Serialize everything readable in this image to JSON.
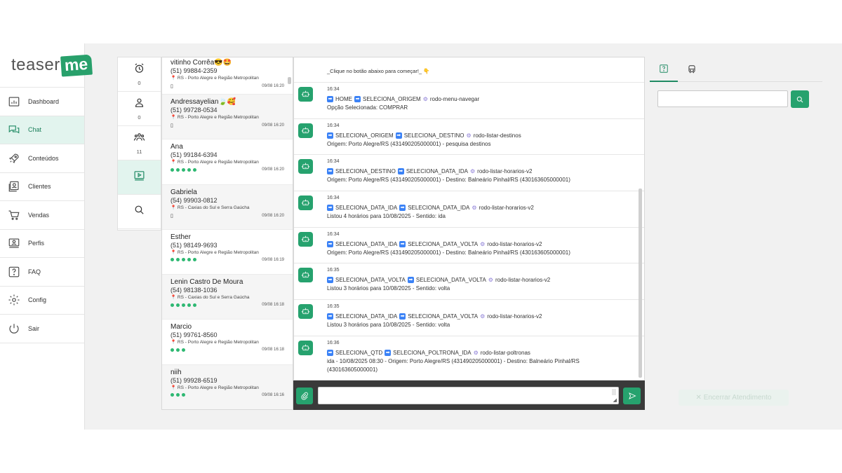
{
  "brand": {
    "word": "teaser",
    "mark": "me"
  },
  "nav": [
    {
      "label": "Dashboard",
      "icon": "chart-icon"
    },
    {
      "label": "Chat",
      "icon": "chat-icon",
      "active": true
    },
    {
      "label": "Conteúdos",
      "icon": "rocket-icon"
    },
    {
      "label": "Clientes",
      "icon": "contacts-icon"
    },
    {
      "label": "Vendas",
      "icon": "cart-icon"
    },
    {
      "label": "Perfis",
      "icon": "profile-icon"
    },
    {
      "label": "FAQ",
      "icon": "question-icon"
    },
    {
      "label": "Config",
      "icon": "gear-icon"
    },
    {
      "label": "Sair",
      "icon": "power-icon"
    }
  ],
  "queues": [
    {
      "icon": "alarm-icon",
      "count": "0"
    },
    {
      "icon": "person-icon",
      "count": "0"
    },
    {
      "icon": "group-icon",
      "count": "11"
    },
    {
      "icon": "play-icon",
      "count": ""
    },
    {
      "icon": "search-icon",
      "count": ""
    }
  ],
  "contacts": [
    {
      "name": "vitinho Corrêa😎🤩",
      "phone": "(51) 99884-2359",
      "region": "RS - Porto Alegre e Região Metropolitan",
      "status": "▯",
      "dots": 0,
      "time": "09/08 16:20"
    },
    {
      "name": "Andressayelian🍃🥰",
      "phone": "(51) 99728-0534",
      "region": "RS - Porto Alegre e Região Metropolitan",
      "status": "▯",
      "dots": 0,
      "time": "09/08 16:20"
    },
    {
      "name": "Ana",
      "phone": "(51) 99184-6394",
      "region": "RS - Porto Alegre e Região Metropolitan",
      "status": "",
      "dots": 5,
      "time": "09/08 16:20"
    },
    {
      "name": "Gabriela",
      "phone": "(54) 99903-0812",
      "region": "RS - Caxias do Sul e Serra Gaúcha",
      "status": "▯",
      "dots": 0,
      "time": "09/08 16:20"
    },
    {
      "name": "Esther",
      "phone": "(51) 98149-9693",
      "region": "RS - Porto Alegre e Região Metropolitan",
      "status": "",
      "dots": 5,
      "time": "09/08 16:19"
    },
    {
      "name": "Lenin Castro De Moura",
      "phone": "(54) 98138-1036",
      "region": "RS - Caxias do Sul e Serra Gaúcha",
      "status": "",
      "dots": 5,
      "time": "09/08 16:18"
    },
    {
      "name": "Marcio",
      "phone": "(51) 99761-8560",
      "region": "RS - Porto Alegre e Região Metropolitan",
      "status": "",
      "dots": 3,
      "time": "09/08 16:18"
    },
    {
      "name": "niih",
      "phone": "(51) 99928-6519",
      "region": "RS - Porto Alegre e Região Metropolitan",
      "status": "",
      "dots": 3,
      "time": "09/08 16:16"
    }
  ],
  "top_message": {
    "text": "_Clique no botão abaixo para começar!_",
    "emoji": "👇"
  },
  "messages": [
    {
      "time": "16:34",
      "from": "HOME",
      "to": "SELECIONA_ORIGEM",
      "action": "rodo-menu-navegar",
      "detail": "Opção Selecionada: COMPRAR"
    },
    {
      "time": "16:34",
      "from": "SELECIONA_ORIGEM",
      "to": "SELECIONA_DESTINO",
      "action": "rodo-listar-destinos",
      "detail": "Origem: Porto Alegre/RS (431490205000001) - pesquisa destinos"
    },
    {
      "time": "16:34",
      "from": "SELECIONA_DESTINO",
      "to": "SELECIONA_DATA_IDA",
      "action": "rodo-listar-horarios-v2",
      "detail": "Origem: Porto Alegre/RS (431490205000001) - Destino: Balneário Pinhal/RS (430163605000001)"
    },
    {
      "time": "16:34",
      "from": "SELECIONA_DATA_IDA",
      "to": "SELECIONA_DATA_IDA",
      "action": "rodo-listar-horarios-v2",
      "detail": "Listou 4 horários para 10/08/2025 - Sentido: ida"
    },
    {
      "time": "16:34",
      "from": "SELECIONA_DATA_IDA",
      "to": "SELECIONA_DATA_VOLTA",
      "action": "rodo-listar-horarios-v2",
      "detail": "Origem: Porto Alegre/RS (431490205000001) - Destino: Balneário Pinhal/RS (430163605000001)"
    },
    {
      "time": "16:35",
      "from": "SELECIONA_DATA_VOLTA",
      "to": "SELECIONA_DATA_VOLTA",
      "action": "rodo-listar-horarios-v2",
      "detail": "Listou 3 horários para 10/08/2025 - Sentido: volta"
    },
    {
      "time": "16:35",
      "from": "SELECIONA_DATA_IDA",
      "to": "SELECIONA_DATA_VOLTA",
      "action": "rodo-listar-horarios-v2",
      "detail": "Listou 3 horários para 10/08/2025 - Sentido: volta"
    },
    {
      "time": "16:36",
      "from": "SELECIONA_QTD",
      "to": "SELECIONA_POLTRONA_IDA",
      "action": "rodo-listar-poltronas",
      "detail": "ida - 10/08/2025 08:30 - Origem: Porto Alegre/RS (431490205000001) - Destino: Balneário Pinhal/RS (430163605000001)"
    }
  ],
  "compose": {
    "value": "",
    "attach_icon": "paperclip-icon",
    "send_icon": "send-icon"
  },
  "right_panel": {
    "tabs": [
      {
        "icon": "question-icon",
        "active": true
      },
      {
        "icon": "bus-icon"
      }
    ],
    "search_value": "",
    "end_button": "✕ Encerrar Atendimento"
  },
  "colors": {
    "accent": "#26a26e",
    "active_bg": "#e2f4ee",
    "compose_bg": "#3a3a3a",
    "dot": "#2eb872"
  }
}
